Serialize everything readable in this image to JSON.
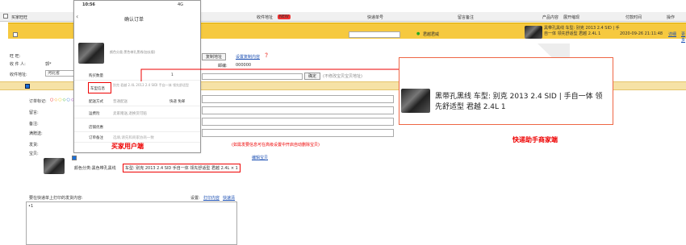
{
  "header": {
    "buyer": "买家旺旺",
    "address": "收件地址",
    "new_badge": "NEW",
    "tracking": "快递单号",
    "remark": "留言备注",
    "product": "产品内容",
    "product_toggle": "展开缩现",
    "paytime": "付款时间",
    "ops": "操作"
  },
  "order": {
    "seller_tag": "君越君威",
    "product_text": "黑带孔黑线 车型: 别克 2013 2.4 SID | 手自一体 领先舒适型 君越 2.4L 1",
    "pay_time": "2020-09-26 21:11:48",
    "detail_link": "详细",
    "more_link": "更多"
  },
  "form": {
    "wangwang_label": "旺 旺:",
    "recipient_label": "收 件 人:",
    "recipient_value": "郭*",
    "address_label": "收件地址:",
    "province_value": "河北省",
    "copy_address_btn": "复制地址",
    "set_copy_link": "设置复制内容",
    "phone_label": "邮编:",
    "phone_value": "000000",
    "confirm_btn": "确定",
    "modify_hint": "(不修改宝贝宝贝地址)",
    "flag_label": "订单标记:",
    "message_label": "留言:",
    "note_label": "备注:",
    "fullgift_label": "满赠送:",
    "shipping_label": "发货:",
    "gift_label": "宝贝:",
    "extra_hint": "(如需发要信息可在高级设置中开启自动删除宝贝)",
    "edit_product_link": "编辑宝贝",
    "product_variant": "颜色分类:黑色带孔黑线",
    "car_model": "车型: 别克 2013 2.4 SID 手自一体 领先舒适型 君越 2.4L × 1",
    "print_label": "要在快递单上打印的发货内容:",
    "print_settings_label": "设置:",
    "print_content_link": "打印内容",
    "clear_link": "快速清",
    "print_value": "•1"
  },
  "phone": {
    "time": "10:56",
    "battery": "4G",
    "title": "确认订单",
    "variant_text": "颜色分类:黑色带孔黑线(加长版)",
    "qty_label": "购买数量",
    "qty_value": "1",
    "car_label": "车型信息",
    "car_value": "别克 君越 2.4L 2013 2.4 SIDI 手自一体 领先舒适型",
    "delivery_label": "配送方式",
    "delivery_value": "普通配送",
    "delivery_tag": "快递 免邮",
    "shipping_label": "运费险",
    "shipping_value": "卖家赠送,退换货可赔",
    "store_coupon_label": "店铺优惠",
    "remark_label": "订单备注",
    "remark_placeholder": "选填,请先和商家协商一致",
    "caption": "买家用户端"
  },
  "callout": {
    "text": "黑带孔黑线 车型: 别克 2013 2.4 SID | 手自一体 领先舒适型 君越 2.4L 1",
    "caption": "快递助手商家端"
  },
  "colors": {
    "accent": "#e00000",
    "bar": "#f6c93f",
    "link": "#1b4fb3"
  }
}
